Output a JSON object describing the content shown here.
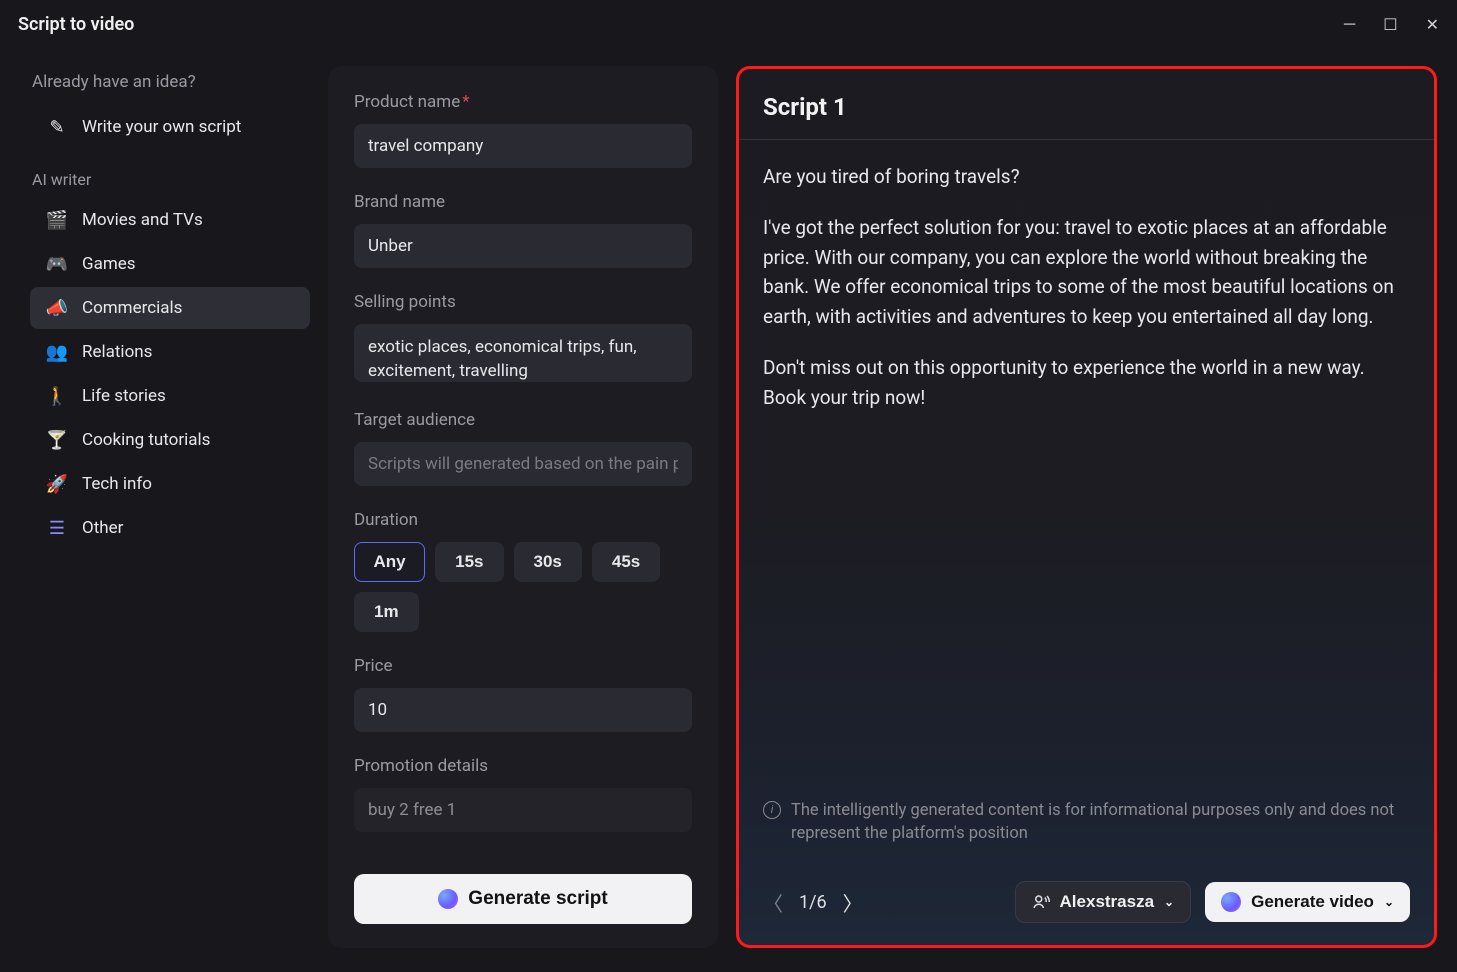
{
  "window": {
    "title": "Script to video"
  },
  "sidebar": {
    "idea_heading": "Already have an idea?",
    "write_own": "Write your own script",
    "ai_writer_heading": "AI writer",
    "items": [
      {
        "label": "Movies and TVs",
        "active": false
      },
      {
        "label": "Games",
        "active": false
      },
      {
        "label": "Commercials",
        "active": true
      },
      {
        "label": "Relations",
        "active": false
      },
      {
        "label": "Life stories",
        "active": false
      },
      {
        "label": "Cooking tutorials",
        "active": false
      },
      {
        "label": "Tech info",
        "active": false
      },
      {
        "label": "Other",
        "active": false
      }
    ]
  },
  "form": {
    "product_name": {
      "label": "Product name",
      "value": "travel company",
      "required": true
    },
    "brand_name": {
      "label": "Brand name",
      "value": "Unber"
    },
    "selling_points": {
      "label": "Selling points",
      "value": "exotic places, economical trips, fun, excitement, travelling"
    },
    "target_audience": {
      "label": "Target audience",
      "placeholder": "Scripts will generated based on the pain p...",
      "value": ""
    },
    "duration": {
      "label": "Duration",
      "options": [
        "Any",
        "15s",
        "30s",
        "45s",
        "1m"
      ],
      "selected": "Any"
    },
    "price": {
      "label": "Price",
      "value": "10"
    },
    "promotion": {
      "label": "Promotion details",
      "value": "buy 2 free 1"
    },
    "generate_button": "Generate script"
  },
  "output": {
    "title": "Script 1",
    "paragraphs": [
      "Are you tired of boring travels?",
      "I've got the perfect solution for you: travel to exotic places at an affordable price. With our company, you can explore the world without breaking the bank. We offer economical trips to some of the most beautiful locations on earth, with activities and adventures to keep you entertained all day long.",
      "Don't miss out on this opportunity to experience the world in a new way. Book your trip now!"
    ],
    "disclaimer": "The intelligently generated content is for informational purposes only and does not represent the platform's position",
    "pager": {
      "current": 1,
      "total": 6,
      "display": "1/6"
    },
    "voice": "Alexstrasza",
    "generate_video": "Generate video"
  }
}
